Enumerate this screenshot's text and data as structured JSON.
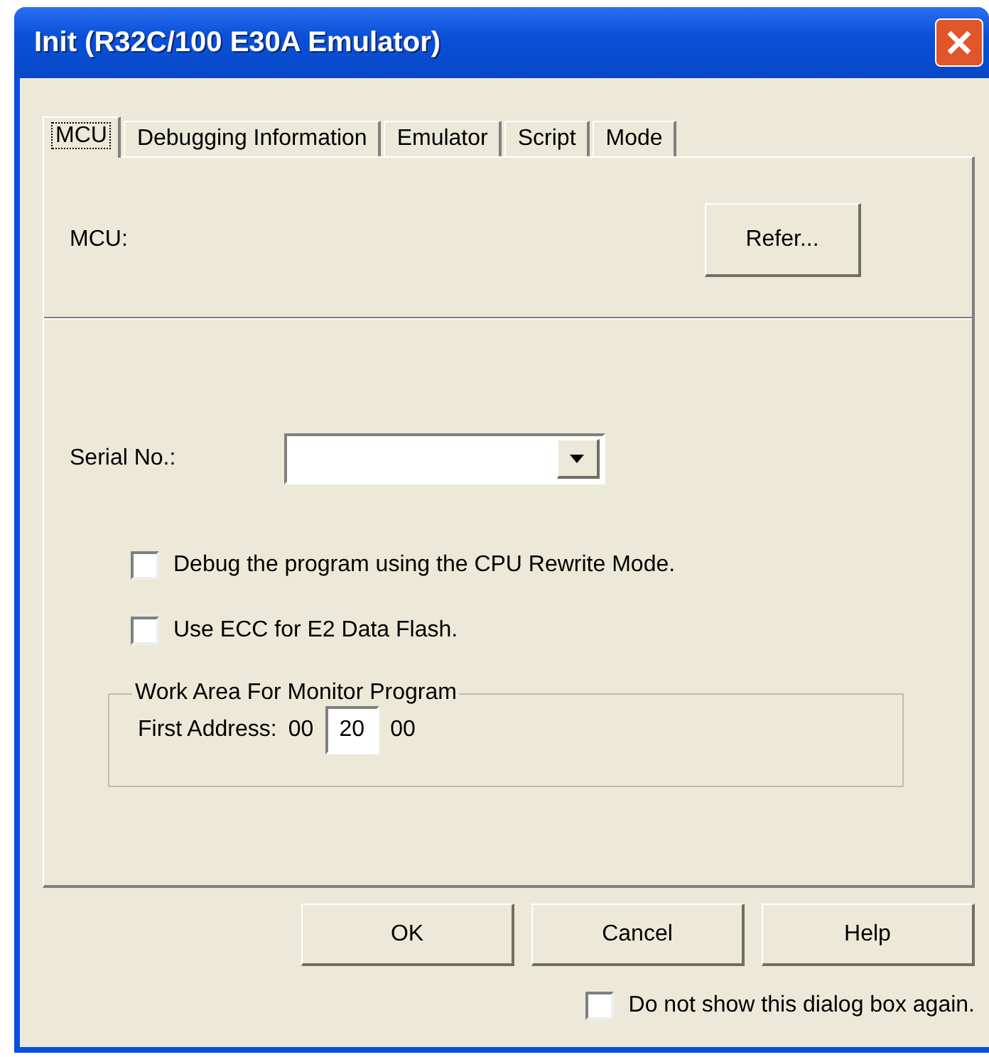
{
  "window": {
    "title": "Init (R32C/100 E30A Emulator)"
  },
  "tabs": [
    {
      "label": "MCU",
      "selected": true
    },
    {
      "label": "Debugging Information",
      "selected": false
    },
    {
      "label": "Emulator",
      "selected": false
    },
    {
      "label": "Script",
      "selected": false
    },
    {
      "label": "Mode",
      "selected": false
    }
  ],
  "mcu": {
    "label": "MCU:",
    "button": "Refer..."
  },
  "serial": {
    "label": "Serial No.:"
  },
  "options": [
    {
      "label": "Debug the program using the CPU Rewrite Mode.",
      "checked": false
    },
    {
      "label": "Use ECC for E2 Data Flash.",
      "checked": false
    }
  ],
  "work_area": {
    "title": "Work Area For Monitor Program",
    "label": "First Address:",
    "prefix": "00",
    "value": "20",
    "suffix": "00"
  },
  "buttons": [
    "OK",
    "Cancel",
    "Help"
  ],
  "dont_show": {
    "label": "Do not show this dialog box again.",
    "checked": false
  }
}
